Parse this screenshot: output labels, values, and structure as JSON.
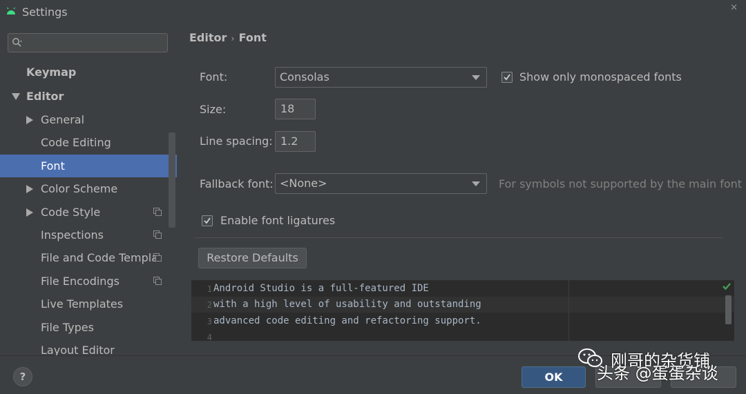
{
  "window": {
    "title": "Settings",
    "close_glyph": "✕",
    "app_icon": "android-icon"
  },
  "search": {
    "placeholder": "",
    "icon": "search-icon"
  },
  "sidebar": {
    "items": [
      {
        "label": "Keymap"
      },
      {
        "label": "Editor"
      },
      {
        "label": "General"
      },
      {
        "label": "Code Editing"
      },
      {
        "label": "Font"
      },
      {
        "label": "Color Scheme"
      },
      {
        "label": "Code Style"
      },
      {
        "label": "Inspections"
      },
      {
        "label": "File and Code Templa"
      },
      {
        "label": "File Encodings"
      },
      {
        "label": "Live Templates"
      },
      {
        "label": "File Types"
      },
      {
        "label": "Layout Editor"
      }
    ],
    "selected": "Font"
  },
  "breadcrumb": {
    "parent": "Editor",
    "separator": "›",
    "current": "Font"
  },
  "form": {
    "font_label": "Font:",
    "font_value": "Consolas",
    "mono_label": "Show only monospaced fonts",
    "mono_checked": true,
    "size_label": "Size:",
    "size_value": "18",
    "spacing_label": "Line spacing:",
    "spacing_value": "1.2",
    "fallback_label": "Fallback font:",
    "fallback_value": "<None>",
    "fallback_hint": "For symbols not supported by the main font",
    "ligatures_label": "Enable font ligatures",
    "ligatures_checked": true,
    "restore_label": "Restore Defaults"
  },
  "preview": {
    "lines": [
      {
        "num": "1",
        "text": "Android Studio is a full-featured IDE"
      },
      {
        "num": "2",
        "text": "with a high level of usability and outstanding"
      },
      {
        "num": "3",
        "text": "advanced code editing and refactoring support."
      },
      {
        "num": "4",
        "text": ""
      }
    ]
  },
  "footer": {
    "help_label": "?",
    "ok_label": "OK"
  },
  "watermark": {
    "line1": "刚哥的杂货铺",
    "line2": "头条 @蛋蛋杂谈"
  },
  "colors": {
    "accent": "#4b6eaf",
    "ok": "#365880",
    "check": "#499c54"
  }
}
